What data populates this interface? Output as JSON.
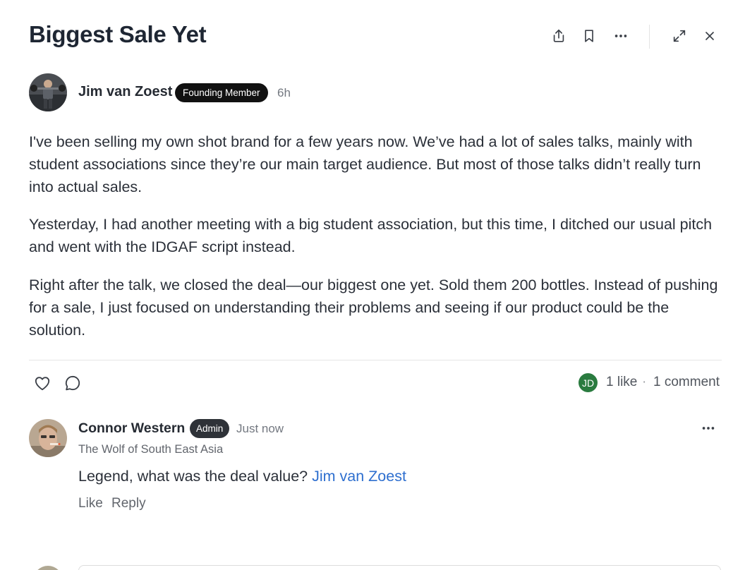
{
  "post": {
    "title": "Biggest Sale Yet",
    "author": {
      "name": "Jim van Zoest",
      "badge": "Founding Member",
      "time": "6h"
    },
    "paragraphs": [
      "I've been selling my own shot brand for a few years now. We’ve had a lot of sales talks, mainly with student associations since they’re our main target audience. But most of those talks didn’t really turn into actual sales.",
      "Yesterday, I had another meeting with a big student association, but this time, I ditched our usual pitch and went with the IDGAF script instead.",
      "Right after the talk, we closed the deal—our biggest one yet. Sold them 200 bottles. Instead of pushing for a sale, I just focused on understanding their problems and seeing if our product could be the solution."
    ]
  },
  "toolbar": {
    "icons": [
      "share-icon",
      "bookmark-icon",
      "more-icon",
      "expand-icon",
      "close-icon"
    ]
  },
  "engagement": {
    "liker_initials": "JD",
    "likes": "1 like",
    "separator": "·",
    "comments": "1 comment"
  },
  "comment": {
    "author": "Connor Western",
    "badge": "Admin",
    "time": "Just now",
    "subtitle": "The Wolf of South East Asia",
    "text": "Legend, what was the deal value?",
    "mention": "Jim van Zoest",
    "like_label": "Like",
    "reply_label": "Reply"
  },
  "colors": {
    "accent_link": "#2e6fcf",
    "liker_avatar": "#2a7b3f",
    "badge_dark": "#111111"
  }
}
